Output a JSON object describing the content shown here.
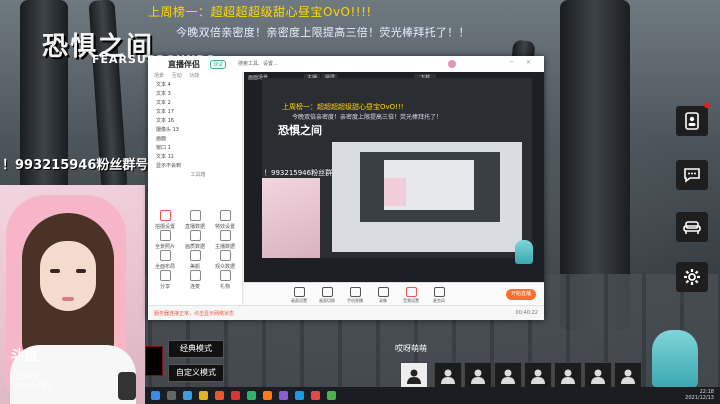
{
  "overlay": {
    "top_line": "上周榜一：超超超超级甜心昼宝OvO!!!!",
    "sub_line": "今晚双倍亲密度！亲密度上限提高三倍！荧光棒拜托了！！",
    "brand": "恐惧之间",
    "brand_sub": "FEARSURROUNDS",
    "fans_group": "！993215946粉丝群号"
  },
  "webcam": {
    "logo": "斗鱼",
    "name": "恐间号",
    "room": "9105451"
  },
  "app": {
    "title": "直播伴侣",
    "badge": "测试",
    "search_hint": "搜索工具、设置…",
    "scene_label": "画面场景",
    "tabs": [
      "主播",
      "竖屏",
      "下载"
    ],
    "left_tabs": [
      "场景",
      "互动",
      "功能"
    ],
    "sources": [
      "文本 4",
      "文本 3",
      "文本 2",
      "文本 17",
      "文本 16",
      "摄像头 13",
      "画面",
      "窗口 1",
      "文本 11",
      "显示不会到"
    ],
    "tools_title": "工具箱",
    "tool_grid": [
      "拍摄设置",
      "直播数据",
      "特效设置",
      "全景照片",
      "画质数据",
      "主播数据",
      "全面布局",
      "美颜",
      "观众数据",
      "分享",
      "连麦",
      "礼物"
    ],
    "preview_toolbar": [
      "画面设置",
      "画面切换",
      "手机直播",
      "录像",
      "音频设置",
      "麦克风"
    ],
    "start_button": "开始直播",
    "status_warning": "服务器连接正常，点击显示网络状态",
    "status_time": "00:40:22"
  },
  "nested_preview": {
    "top_line": "上周榜一：超超超超级甜心昼宝OvO!!!",
    "sub_line": "今晚双倍亲密度！亲密度上限提高三倍！荧光棒拜托了！",
    "brand": "恐惧之间",
    "fans": "！993215946粉丝群号"
  },
  "modes": {
    "classic": "经典模式",
    "custom": "自定义模式"
  },
  "emoji_bar": {
    "label": "哎呀萌萌"
  },
  "taskbar": {
    "time": "22:18",
    "date": "2021/12/13"
  },
  "right_buttons": [
    "contacts-icon",
    "chat-icon",
    "sofa-icon",
    "gear-icon"
  ]
}
